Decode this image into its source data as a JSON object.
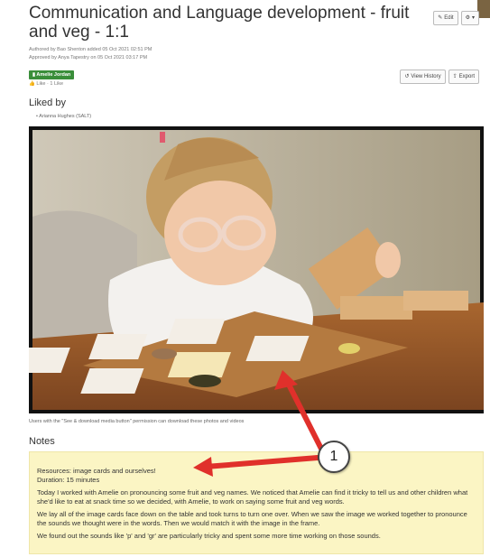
{
  "title": "Communication and Language development - fruit and veg - 1:1",
  "actions": {
    "edit_label": "Edit",
    "more_label": "▾",
    "history_label": "View History",
    "export_label": "Export"
  },
  "meta": {
    "authored": "Authored by Bao Shenton added 05 Oct 2021 02:51 PM",
    "approved": "Approved by Anya Tapestry on 05 Oct 2021 03:17 PM"
  },
  "child_tag": "Amelie Jordan",
  "likes_line": "Like · 1 Like",
  "liked_by": {
    "title": "Liked by",
    "items": [
      "Arianna Hughes (SALT)"
    ]
  },
  "caption": {
    "prefix": "Users with the \"See & download media button\" permission can download these photos and videos",
    "link": ""
  },
  "notes": {
    "title": "Notes",
    "lines": [
      "Resources: image cards and ourselves!",
      "Duration: 15 minutes",
      "Today I worked with Amelie on pronouncing some fruit and veg names. We noticed that Amelie can find it tricky to tell us and other children what she'd like to eat at snack time so we decided, with Amelie, to work on saying some fruit and veg words.",
      "We lay all of the image cards face down on the table and took turns to turn one over. When we saw the image we worked together to pronounce the sounds we thought were in the words. Then we would match it with the image in the frame.",
      "We found out the sounds like 'p' and 'gr' are particularly tricky and spent some more time working on those sounds."
    ]
  },
  "annotation": {
    "number": "1",
    "color": "#e0302b"
  },
  "colors": {
    "tag": "#3a8e3a",
    "notes_bg": "#fbf5c4",
    "link": "#2a6fb5"
  }
}
